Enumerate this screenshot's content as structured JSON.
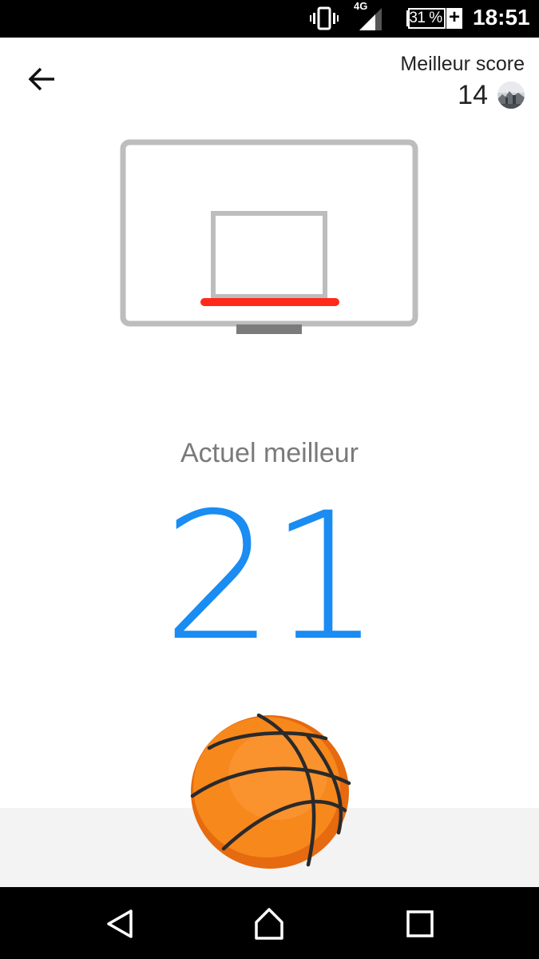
{
  "status_bar": {
    "network": "4G",
    "battery": "31 %",
    "time": "18:51"
  },
  "header": {
    "back_icon": "arrow-left-icon",
    "best_score_label": "Meilleur score",
    "best_score_value": "14"
  },
  "game": {
    "current_label": "Actuel meilleur",
    "current_score": "21",
    "rim_color": "#ff2a1a",
    "score_color": "#1a8cf2",
    "ball_color": "#f7881c"
  },
  "nav_bar": {
    "back_icon": "triangle-back-icon",
    "home_icon": "house-home-icon",
    "recents_icon": "square-recents-icon"
  }
}
